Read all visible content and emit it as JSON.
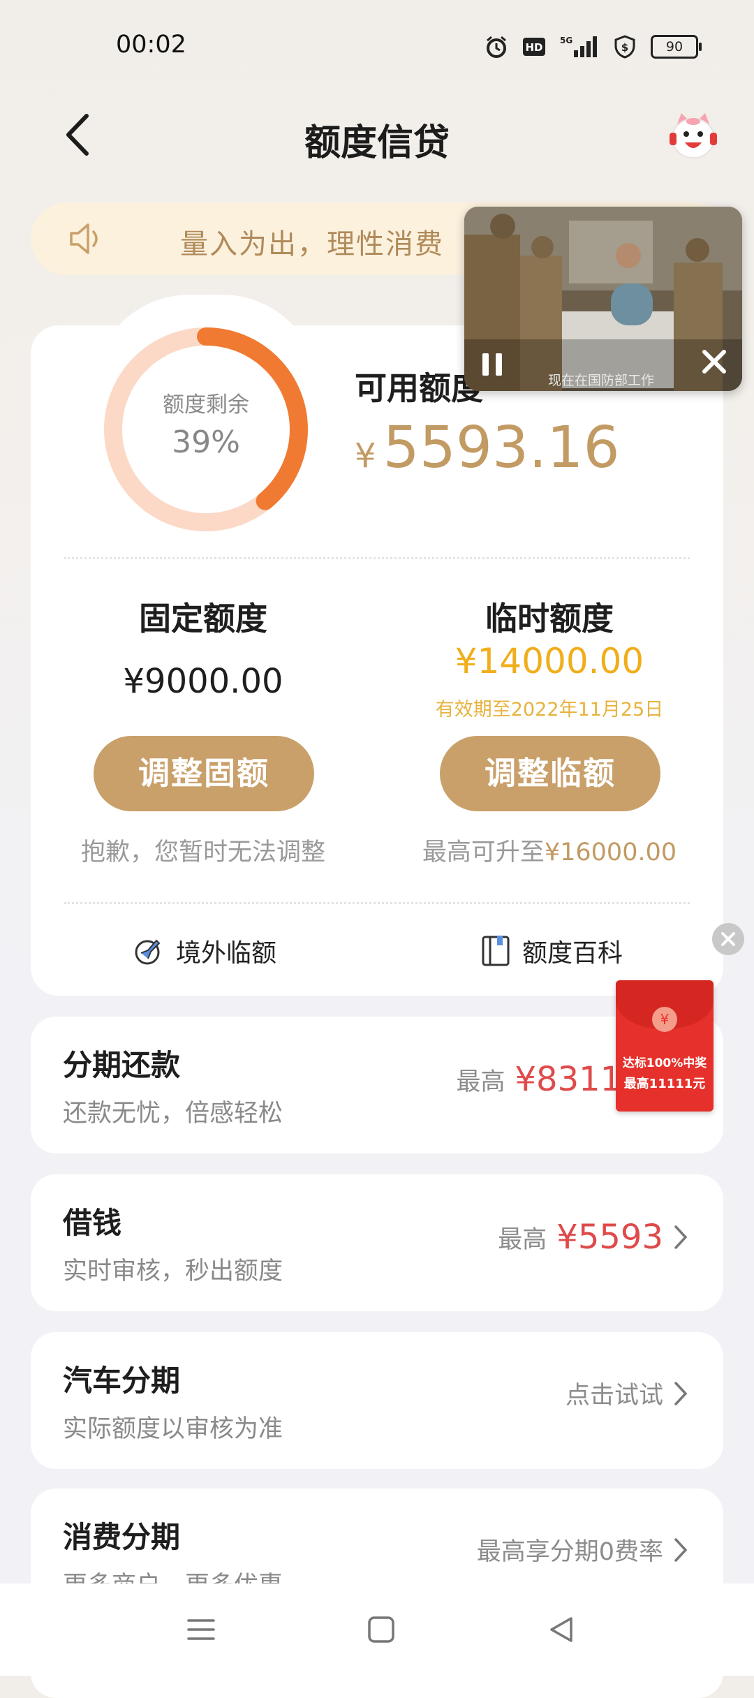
{
  "status_bar": {
    "time": "00:02",
    "icons": [
      "alarm-icon",
      "hd-icon",
      "5g-signal-icon",
      "shield-icon"
    ],
    "battery": "90"
  },
  "header": {
    "title": "额度信贷"
  },
  "notice": {
    "text": "量入为出，理性消费"
  },
  "video": {
    "subtitle": "现在在国防部工作"
  },
  "credit": {
    "ring_label": "额度剩余",
    "ring_percent": "39%",
    "ring_fraction": 0.39,
    "available_label": "可用额度",
    "currency": "¥",
    "available_amount": "5593.16"
  },
  "fixed": {
    "title": "固定额度",
    "amount": "¥9000.00",
    "button": "调整固额",
    "note": "抱歉，您暂时无法调整"
  },
  "temporary": {
    "title": "临时额度",
    "amount": "¥14000.00",
    "valid": "有效期至2022年11月25日",
    "button": "调整临额",
    "note_prefix": "最高可升至",
    "note_amount": "¥16000.00"
  },
  "links": {
    "overseas": "境外临额",
    "wiki": "额度百科"
  },
  "rows": [
    {
      "title": "分期还款",
      "subtitle": "还款无忧，倍感轻松",
      "prefix": "最高",
      "amount": "¥8311.0"
    },
    {
      "title": "借钱",
      "subtitle": "实时审核，秒出额度",
      "prefix": "最高",
      "amount": "¥5593"
    },
    {
      "title": "汽车分期",
      "subtitle": "实际额度以审核为准",
      "prefix": "点击试试",
      "amount": ""
    },
    {
      "title": "消费分期",
      "subtitle": "更多商户，更多优惠",
      "prefix": "最高享分期0费率",
      "amount": ""
    }
  ],
  "red_packet": {
    "coin": "¥",
    "line1": "达标100%中奖",
    "line2": "最高11111元"
  },
  "colors": {
    "gold": "#c9a06a",
    "ring_active": "#f07a32",
    "ring_track": "#fbd9c6",
    "red": "#df4a4a",
    "temp_amount": "#f0ae1c"
  }
}
